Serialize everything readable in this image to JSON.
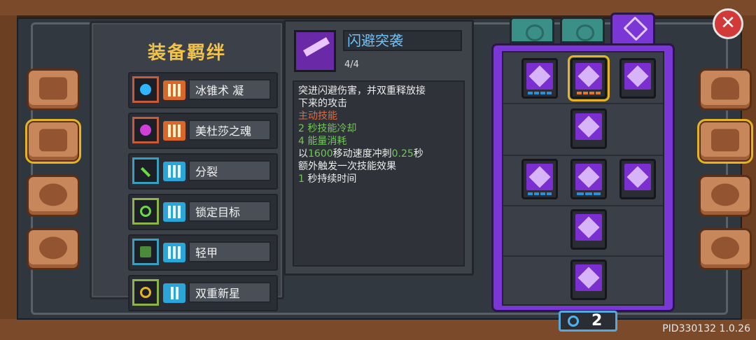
{
  "window": {
    "close_label": "✕"
  },
  "left_tabs": [
    {
      "name": "book-tab",
      "icon": "book-icon",
      "selected": false
    },
    {
      "name": "bond-tab",
      "icon": "scroll-icon",
      "selected": true
    },
    {
      "name": "team-tab",
      "icon": "cluster-icon",
      "selected": false
    },
    {
      "name": "wheel-tab",
      "icon": "steering-icon",
      "selected": false
    }
  ],
  "right_tabs": [
    {
      "name": "helmet-tab",
      "icon": "helmet-icon",
      "selected": false
    },
    {
      "name": "skills-tab",
      "icon": "swords-up-icon",
      "selected": true
    },
    {
      "name": "compass-tab",
      "icon": "compass-icon",
      "selected": false
    },
    {
      "name": "gear-tab",
      "icon": "gear-icon",
      "selected": false
    }
  ],
  "bonds_panel": {
    "title": "装备羁绊",
    "items": [
      {
        "label": "冰锥术 凝",
        "bars": 3,
        "color": "orange",
        "icon": "ice-orb-icon"
      },
      {
        "label": "美杜莎之魂",
        "bars": 3,
        "color": "orange",
        "icon": "medusa-orb-icon"
      },
      {
        "label": "分裂",
        "bars": 3,
        "color": "cyan",
        "icon": "split-arrow-icon"
      },
      {
        "label": "锁定目标",
        "bars": 3,
        "color": "cyan",
        "icon": "target-icon"
      },
      {
        "label": "轻甲",
        "bars": 3,
        "color": "cyan",
        "icon": "light-armor-icon"
      },
      {
        "label": "双重新星",
        "bars": 2,
        "color": "cyan",
        "icon": "double-nova-icon"
      }
    ]
  },
  "skill_detail": {
    "title": "闪避突袭",
    "level": "4/4",
    "desc_lines": [
      {
        "text": "突进闪避伤害，并双重释放接",
        "style": "normal"
      },
      {
        "text": "下来的攻击",
        "style": "normal"
      },
      {
        "text": "主动技能",
        "style": "red"
      },
      {
        "text": "2 秒技能冷却",
        "style": "green"
      },
      {
        "text": "4 能量消耗",
        "style": "green"
      }
    ],
    "desc_rich": {
      "line6_a": "以",
      "line6_b": "1600",
      "line6_c": "移动速度冲刺",
      "line6_d": "0.25",
      "line6_e": "秒",
      "line7": "额外触发一次技能效果",
      "line8_a": "1",
      "line8_b": " 秒持续时间"
    }
  },
  "skill_tree": {
    "tabs": [
      {
        "name": "tree-tab-1",
        "active": false
      },
      {
        "name": "tree-tab-2",
        "active": false
      },
      {
        "name": "tree-tab-3",
        "active": true
      }
    ],
    "rows": [
      [
        {
          "icon": "burst-skill-icon",
          "selected": false
        },
        {
          "icon": "dash-skill-icon",
          "selected": true
        },
        {
          "icon": "plus-shield-icon",
          "selected": false
        }
      ],
      [
        {
          "icon": "sword-slash-icon",
          "selected": false
        }
      ],
      [
        {
          "icon": "heart-rune-icon",
          "selected": false
        },
        {
          "icon": "pillar-icon",
          "selected": false
        },
        {
          "icon": "shield-emblem-icon",
          "selected": false
        }
      ],
      [
        {
          "icon": "lightning-dash-icon",
          "selected": false
        }
      ],
      [
        {
          "icon": "cross-slash-icon",
          "selected": false
        }
      ]
    ]
  },
  "counter": {
    "value": "2",
    "icon": "swirl-icon"
  },
  "version": "PID330132 1.0.26"
}
